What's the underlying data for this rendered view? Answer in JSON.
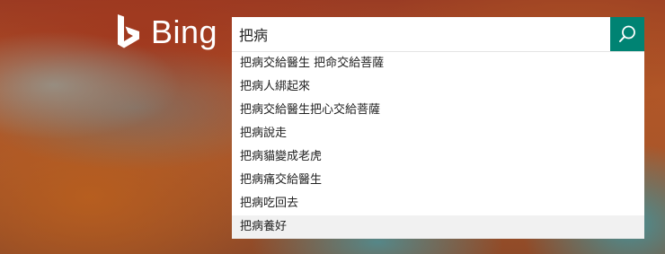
{
  "logo": {
    "text": "Bing",
    "icon": "bing-logo-icon"
  },
  "search": {
    "query": "把病",
    "button_icon": "search-icon",
    "accent_color": "#008373"
  },
  "suggestions": [
    "把病交給醫生 把命交給菩薩",
    "把病人綁起來",
    "把病交給醫生把心交給菩薩",
    "把病說走",
    "把病貓變成老虎",
    "把病痛交給醫生",
    "把病吃回去",
    "把病養好"
  ],
  "highlighted_index": 7
}
